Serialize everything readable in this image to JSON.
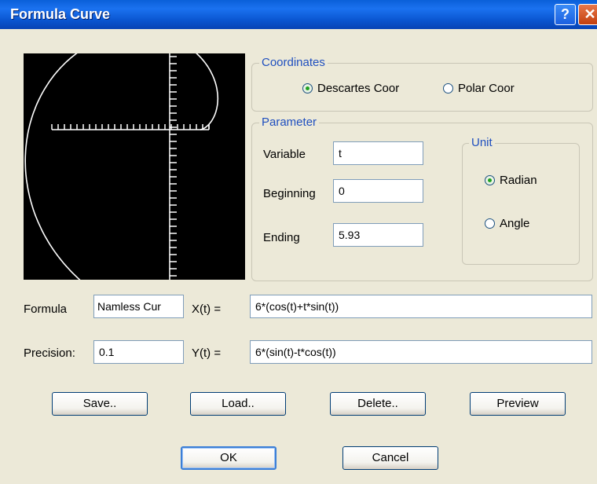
{
  "window": {
    "title": "Formula Curve",
    "help_glyph": "?",
    "close_glyph": "✕"
  },
  "coordinates": {
    "legend": "Coordinates",
    "options": [
      {
        "label": "Descartes Coor",
        "selected": true
      },
      {
        "label": "Polar Coor",
        "selected": false
      }
    ]
  },
  "parameter": {
    "legend": "Parameter",
    "variable_label": "Variable",
    "variable_value": "t",
    "beginning_label": "Beginning",
    "beginning_value": "0",
    "ending_label": "Ending",
    "ending_value": "5.93"
  },
  "unit": {
    "legend": "Unit",
    "options": [
      {
        "label": "Radian",
        "selected": true
      },
      {
        "label": "Angle",
        "selected": false
      }
    ]
  },
  "formula": {
    "label": "Formula",
    "name_value": "Namless Cur",
    "x_label": "X(t) =",
    "x_value": "6*(cos(t)+t*sin(t))",
    "precision_label": "Precision:",
    "precision_value": "0.1",
    "y_label": "Y(t) =",
    "y_value": "6*(sin(t)-t*cos(t))"
  },
  "buttons": {
    "save": "Save..",
    "load": "Load..",
    "delete": "Delete..",
    "preview": "Preview",
    "ok": "OK",
    "cancel": "Cancel"
  },
  "colors": {
    "title_bar": "#0a55d0",
    "legend_text": "#1f4fbf",
    "dialog_bg": "#ece9d8",
    "preview_bg": "#000000",
    "curve": "#ffffff"
  }
}
